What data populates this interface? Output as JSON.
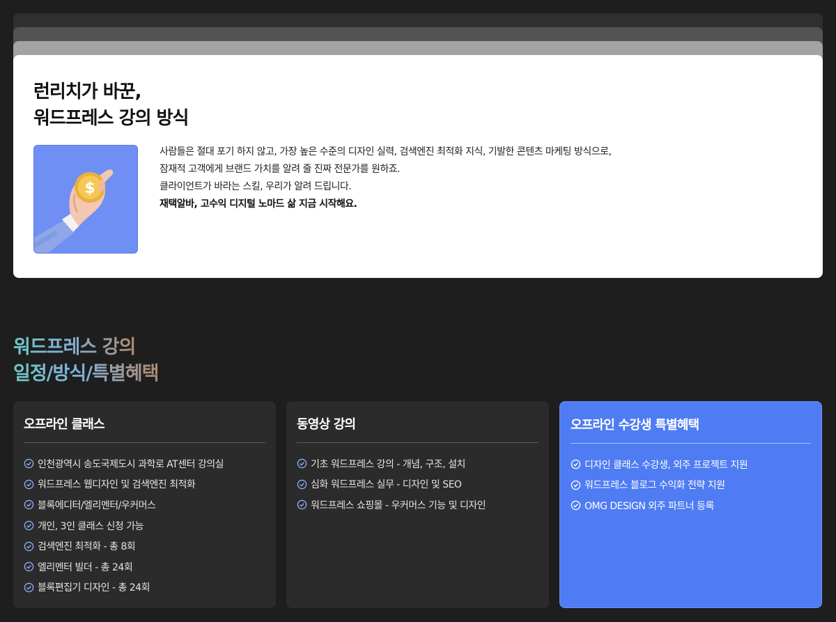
{
  "hero": {
    "title_line1": "런리치가 바꾼,",
    "title_line2": "워드프레스 강의 방식",
    "image_icon": "coin-hand-illustration",
    "paragraphs": [
      "사람들은 절대 포기 하지 않고, 가장 높은 수준의 디자인 실력, 검색엔진 최적화 지식, 기발한 콘텐츠 마케팅 방식으로,",
      "잠재적 고객에게 브랜드 가치를 알려 줄 진짜 전문가를 원하죠.",
      "클라이언트가 바라는 스킬, 우리가 알려 드립니다."
    ],
    "bold_line": "재택알바, 고수익 디지털 노마드 삶 지금 시작해요."
  },
  "section": {
    "title_line1": "워드프레스 강의",
    "title_line2": "일정/방식/특별혜택"
  },
  "cards": [
    {
      "title": "오프라인 클래스",
      "items": [
        "인천광역시 송도국제도시 과학로 AT센터 강의실",
        "워드프레스 웹디자인 및 검색엔진 최적화",
        "블록에디터/엘리멘터/우커머스",
        "개인, 3인 클래스 신청 가능",
        "검색엔진 최적화 - 총 8회",
        "엘리멘터 빌더 - 총 24회",
        "블록편집기 디자인 - 총 24회"
      ]
    },
    {
      "title": "동영상 강의",
      "items": [
        "기초 워드프레스 강의 - 개념, 구조, 설치",
        "심화 워드프레스 실무 - 디자인 및 SEO",
        "워드프레스 쇼핑몰 - 우커머스 기능 및 디자인"
      ]
    },
    {
      "title": "오프라인 수강생 특별혜택",
      "items": [
        "디자인 클래스 수강생, 외주 프로젝트 지원",
        "워드프레스 블로그 수익화 전략 지원",
        "OMG DESIGN 외주 파트너 등록"
      ]
    }
  ],
  "colors": {
    "background": "#1e1e1e",
    "card_dark": "#2b2b2b",
    "card_accent": "#4f7cf3",
    "check_icon": "#8fb0ff"
  }
}
